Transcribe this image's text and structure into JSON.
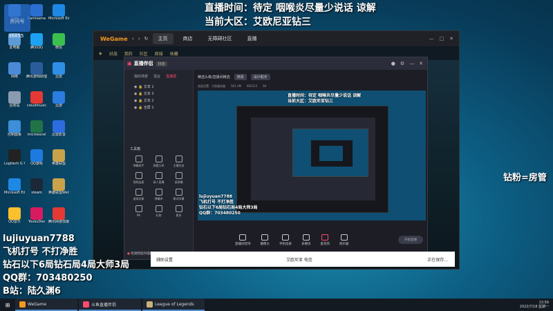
{
  "desktop": {
    "icons": [
      {
        "label": "Adm"
      },
      {
        "label": "Kamisama"
      },
      {
        "label": "Microsoft Edge"
      },
      {
        "label": "此电脑"
      },
      {
        "label": "腾讯QQ"
      },
      {
        "label": "微信"
      },
      {
        "label": "网络"
      },
      {
        "label": "腾讯游戏助理"
      },
      {
        "label": "迅雷"
      },
      {
        "label": "回收站"
      },
      {
        "label": "cloudmusic"
      },
      {
        "label": "迅游"
      },
      {
        "label": "控制面板"
      },
      {
        "label": "microexcel"
      },
      {
        "label": "迅雷影音"
      },
      {
        "label": "Logitech G HUB"
      },
      {
        "label": "QQ游戏"
      },
      {
        "label": "英雄联盟"
      },
      {
        "label": "Microsoft Edge"
      },
      {
        "label": "steam"
      },
      {
        "label": "英雄联盟WeGame版"
      },
      {
        "label": "QQ音乐"
      },
      {
        "label": "YoukuDes"
      },
      {
        "label": "腾讯网游加速器"
      }
    ],
    "logo_label": "房间号",
    "logo_number": "36855"
  },
  "overlay": {
    "top_line1": "直播时间：待定  咽喉炎尽量少说话 谅解",
    "top_line2": "当前大区：艾欧尼亚钻三",
    "bottom_lines": [
      "lujiuyuan7788",
      "飞机打号 不打净胜",
      "钻石以下6局钻石局4局大师3局",
      "QQ群：703480250",
      "B站：陆久渊6"
    ],
    "right_text": "钻粉=房管"
  },
  "wegame": {
    "logo": "WeGame",
    "tabs": [
      "主页",
      "商店",
      "无障碍社区",
      "直播"
    ],
    "lol_bar": [
      "对战",
      "我的",
      "社区",
      "商城",
      "收藏"
    ]
  },
  "zhibo": {
    "title": "直播伴侣",
    "badge": "抖音",
    "side_tabs": [
      "我的场景",
      "混合",
      "直播源"
    ],
    "sources": [
      "文本 1",
      "文本 3",
      "文本 2",
      "全屏 1"
    ],
    "tools_header": "工具箱",
    "tools": [
      "弹幕助手",
      "观看分享",
      "主播任务",
      "视频连麦",
      "录人直播",
      "录屏播",
      "虚拟形象",
      "弹幕库",
      "歌词字幕",
      "PK",
      "礼物",
      "更多"
    ],
    "warn_prefix": "检测到您",
    "warn_text": "的电脑性能可能不足",
    "top_title": "精选头像/直播间精选",
    "top_pills": [
      "修改",
      "设计助手"
    ],
    "sub_info": [
      "画面设置：大陆服务器",
      "5K1.3M",
      "665515",
      "84"
    ],
    "bottom_buttons": [
      "直播间装饰",
      "摄像头",
      "手机投屏",
      "多模块",
      "麦克风",
      "扬声器"
    ],
    "go_live": "开始直播"
  },
  "input_strip": [
    "辅助设置",
    "艾欧尼亚 电信",
    "正在保存..."
  ],
  "taskbar": {
    "items": [
      "WeGame",
      "斗鱼直播伴侣",
      "League of Legends"
    ],
    "time": "13:59",
    "date": "2022/7/18 星期一"
  }
}
